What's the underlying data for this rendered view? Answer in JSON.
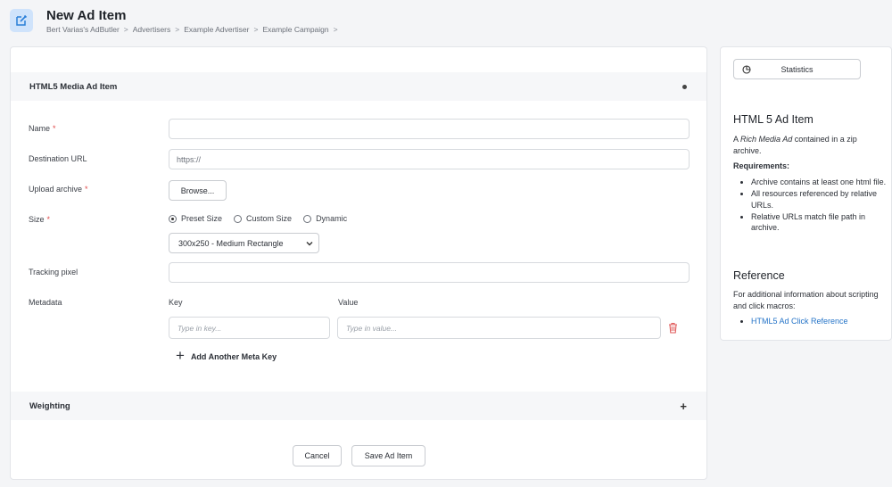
{
  "header": {
    "title": "New Ad Item",
    "breadcrumb": [
      "Bert Varias's AdButler",
      "Advertisers",
      "Example Advertiser",
      "Example Campaign"
    ],
    "breadcrumb_sep": ">",
    "accent": "#2a7fd8"
  },
  "form": {
    "section_title": "HTML5 Media Ad Item",
    "name_label": "Name",
    "name_value": "",
    "url_label": "Destination URL",
    "url_value": "https://",
    "upload_label": "Upload archive",
    "browse_label": "Browse...",
    "size_label": "Size",
    "size_options": [
      "Preset Size",
      "Custom Size",
      "Dynamic"
    ],
    "size_selected": "Preset Size",
    "preset_value": "300x250 - Medium Rectangle",
    "tracking_label": "Tracking pixel",
    "tracking_value": "",
    "metadata_label": "Metadata",
    "key_label": "Key",
    "value_label": "Value",
    "key_placeholder": "Type in key...",
    "value_placeholder": "Type in value...",
    "add_meta_label": "Add Another Meta Key",
    "required_mark": "*",
    "weighting_title": "Weighting",
    "cancel_label": "Cancel",
    "save_label": "Save Ad Item"
  },
  "sidebar": {
    "stats_label": "Statistics",
    "heading": "HTML 5 Ad Item",
    "intro_pre": "A ",
    "intro_em": "Rich Media Ad",
    "intro_post": " contained in a zip archive.",
    "req_heading": "Requirements:",
    "requirements": [
      "Archive contains at least one html file.",
      "All resources referenced by relative URLs.",
      "Relative URLs match file path in archive."
    ],
    "ref_heading": "Reference",
    "ref_text": "For additional information about scripting and click macros:",
    "ref_link": "HTML5 Ad Click Reference"
  }
}
